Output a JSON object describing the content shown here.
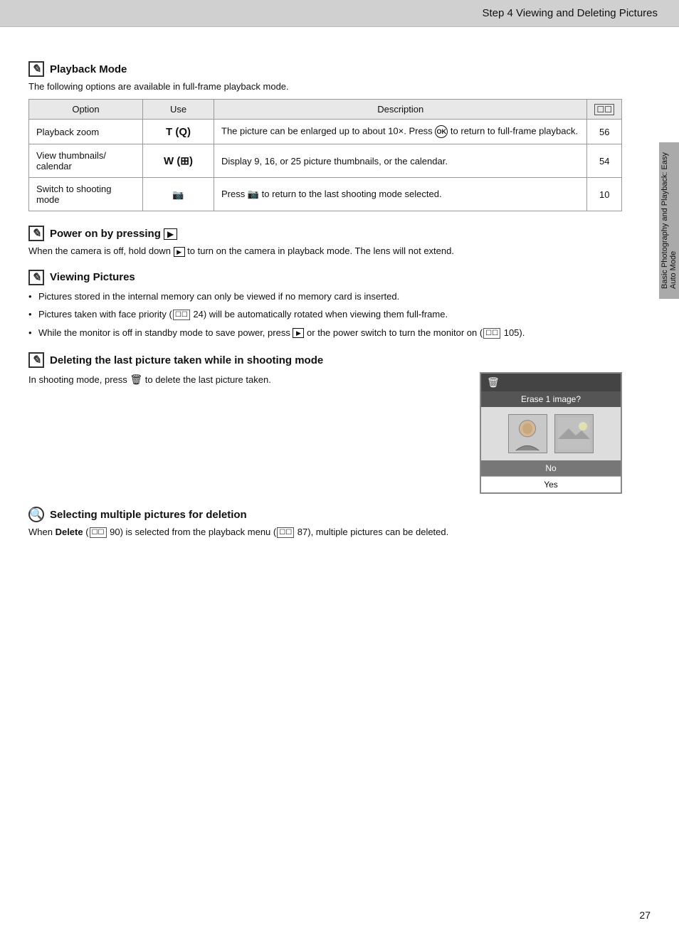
{
  "header": {
    "title": "Step 4 Viewing and Deleting Pictures"
  },
  "sidebar": {
    "label": "Basic Photography and Playback: Easy Auto Mode"
  },
  "playback_mode": {
    "icon": "✎",
    "heading": "Playback Mode",
    "description": "The following options are available in full-frame playback mode.",
    "table": {
      "columns": [
        "Option",
        "Use",
        "Description",
        "☐☐"
      ],
      "rows": [
        {
          "option": "Playback zoom",
          "use": "T (🔍)",
          "use_display": "T",
          "use_sub": "(Q)",
          "description": "The picture can be enlarged up to about 10×. Press ⊛ to return to full-frame playback.",
          "ref": "56"
        },
        {
          "option": "View thumbnails/ calendar",
          "use_display": "W",
          "use_sub": "(⊞)",
          "description": "Display 9, 16, or 25 picture thumbnails, or the calendar.",
          "ref": "54"
        },
        {
          "option": "Switch to shooting mode",
          "use_display": "📷",
          "use_sub": "",
          "description": "Press 📷 to return to the last shooting mode selected.",
          "ref": "10"
        }
      ]
    }
  },
  "power_on": {
    "icon": "✎",
    "heading": "Power on by pressing ▶",
    "description": "When the camera is off, hold down ▶ to turn on the camera in playback mode. The lens will not extend."
  },
  "viewing_pictures": {
    "icon": "✎",
    "heading": "Viewing Pictures",
    "bullets": [
      "Pictures stored in the internal memory can only be viewed if no memory card is inserted.",
      "Pictures taken with face priority (☐☐ 24) will be automatically rotated when viewing them full-frame.",
      "While the monitor is off in standby mode to save power, press ▶ or the power switch to turn the monitor on (☐☐ 105)."
    ]
  },
  "deleting": {
    "icon": "✎",
    "heading": "Deleting the last picture taken while in shooting mode",
    "description": "In shooting mode, press 🗑 to delete the last picture taken.",
    "screen": {
      "erase_label": "Erase 1 image?",
      "no_label": "No",
      "yes_label": "Yes"
    }
  },
  "selecting": {
    "icon": "🔍",
    "heading": "Selecting multiple pictures for deletion",
    "description": "When Delete (☐☐ 90) is selected from the playback menu (☐☐ 87), multiple pictures can be deleted."
  },
  "page_number": "27"
}
